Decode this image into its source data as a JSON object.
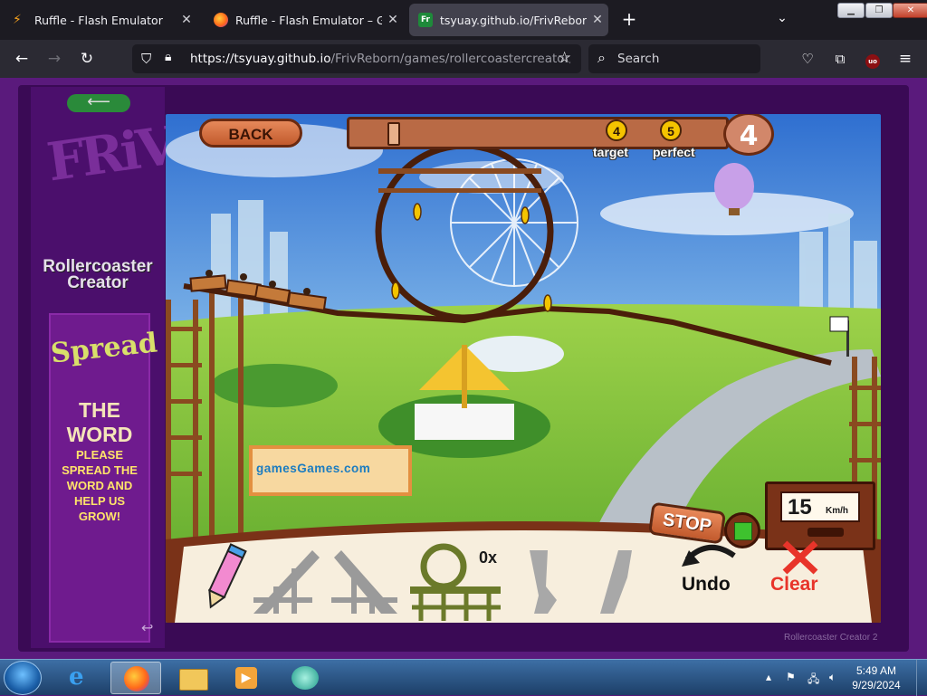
{
  "browser": {
    "tabs": [
      {
        "title": "Ruffle - Flash Emulator",
        "icon": "ruffle-icon",
        "close": "✕"
      },
      {
        "title": "Ruffle - Flash Emulator – Get th",
        "icon": "firefox-icon",
        "close": "✕"
      },
      {
        "title": "tsyuay.github.io/FrivReborn/ga",
        "icon": "friv-icon",
        "close": "✕"
      }
    ],
    "new_tab": "+",
    "url_host": "https://tsyuay.github.io",
    "url_path": "/FrivReborn/games/rollercoastercreator/fl",
    "search_placeholder": "Search"
  },
  "sidebar": {
    "logo": "FRiV",
    "game_title": "Rollercoaster Creator",
    "spread": "Spread",
    "the_word": "THE WORD",
    "please": "PLEASE SPREAD THE WORD AND HELP US GROW!",
    "back_glyph": "↩"
  },
  "game": {
    "back_label": "BACK",
    "target_value": "4",
    "target_label": "target",
    "perfect_value": "5",
    "perfect_label": "perfect",
    "end_value": "4",
    "sign_text": "gamesGames.com",
    "speed_value": "15",
    "speed_unit": "Km/h",
    "stop_label": "STOP",
    "loop_count": "0x",
    "undo_label": "Undo",
    "clear_label": "Clear",
    "credit": "Rollercoaster Creator 2"
  },
  "taskbar": {
    "time": "5:49 AM",
    "date": "9/29/2024"
  },
  "colors": {
    "page_bg": "#5a1a7c",
    "track": "#5a2510",
    "accent_orange": "#c25a2d",
    "clear_red": "#e8342a"
  }
}
